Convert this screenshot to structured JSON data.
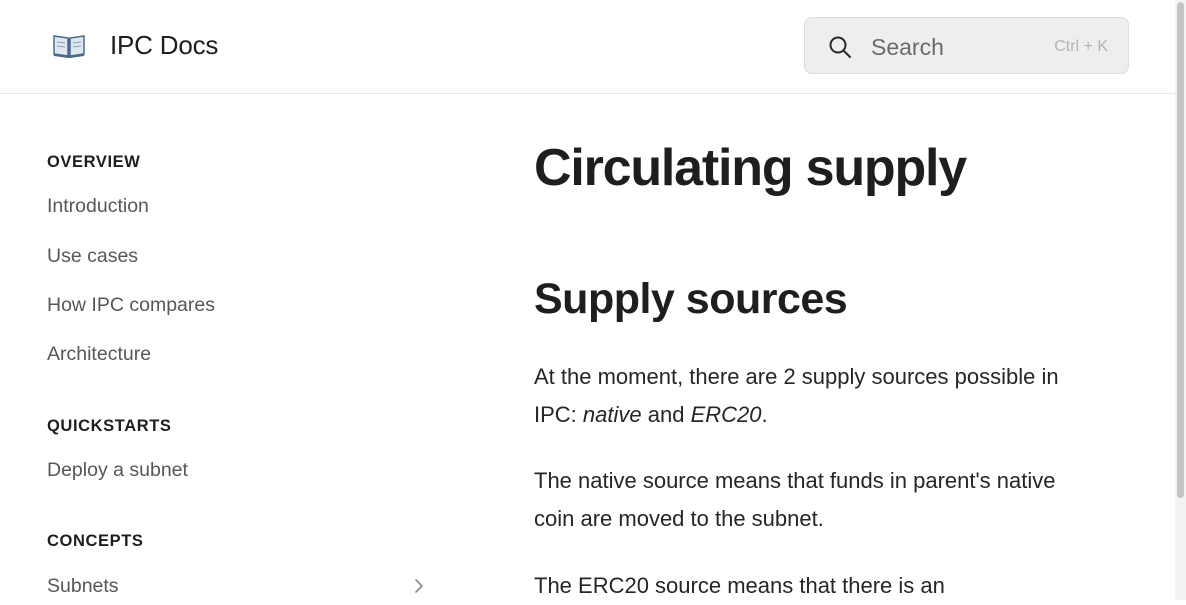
{
  "header": {
    "logo_icon": "open-book-icon",
    "site_title": "IPC Docs",
    "search": {
      "placeholder": "Search",
      "shortcut": "Ctrl + K",
      "icon": "search-icon"
    }
  },
  "sidebar": {
    "sections": [
      {
        "title": "OVERVIEW",
        "items": [
          "Introduction",
          "Use cases",
          "How IPC compares",
          "Architecture"
        ]
      },
      {
        "title": "QUICKSTARTS",
        "items": [
          "Deploy a subnet"
        ]
      },
      {
        "title": "CONCEPTS",
        "items": [
          "Subnets"
        ]
      }
    ],
    "expand_icon": "chevron-right-icon"
  },
  "main": {
    "title": "Circulating supply",
    "section_heading": "Supply sources",
    "paragraphs": {
      "p1": {
        "before": "At the moment, there are 2 supply sources possible in IPC: ",
        "em1": "native",
        "middle": " and ",
        "em2": "ERC20",
        "after": "."
      },
      "p2": "The native source means that funds in parent's native coin are moved to the subnet.",
      "p3": "The ERC20 source means that there is an"
    }
  },
  "colors": {
    "text_primary": "#1e1e1e",
    "text_nav": "#575757",
    "search_bg": "#eeeeee",
    "border": "#e9e9e9"
  }
}
